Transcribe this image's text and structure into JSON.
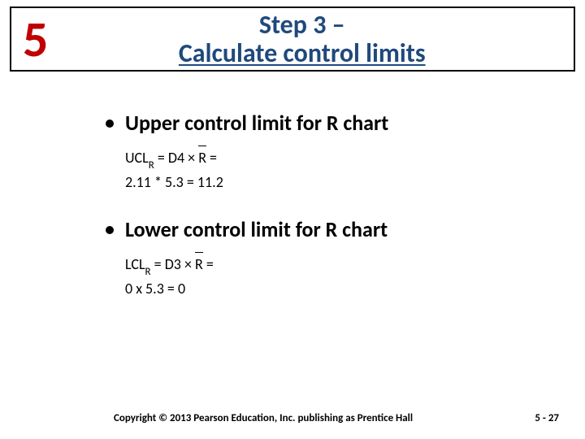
{
  "header": {
    "step_number": "5",
    "title_line1": "Step 3 –",
    "title_line2": "Calculate control limits"
  },
  "sections": {
    "ucl": {
      "title": "Upper control limit for R chart",
      "formula_prefix": "UCL",
      "formula_sub": "R",
      "formula_rhs": " = D4  ×",
      "rbar": "R",
      "formula_tail": "  =",
      "computation": "2.11 * 5.3 = 11.2"
    },
    "lcl": {
      "title": "Lower control limit for R chart",
      "formula_prefix": "LCL",
      "formula_sub": "R",
      "formula_rhs": " = D3  ×",
      "rbar": "R",
      "formula_tail": " =",
      "computation": "0 x 5.3 = 0"
    }
  },
  "footer": {
    "copyright": "Copyright © 2013 Pearson Education, Inc. publishing as Prentice Hall",
    "page": "5 - 27"
  }
}
